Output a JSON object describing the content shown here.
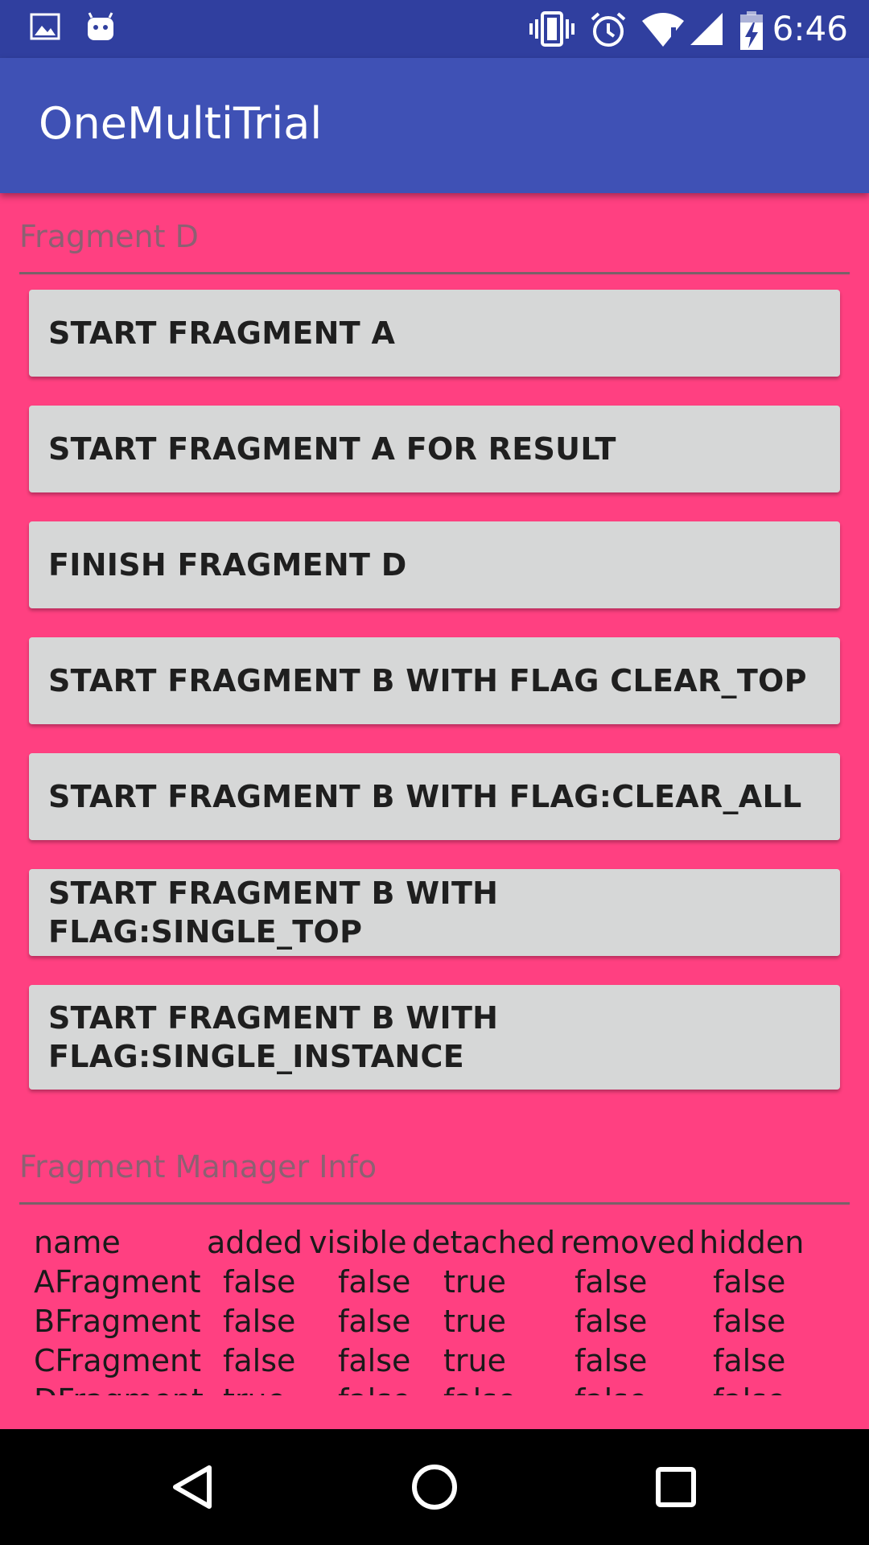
{
  "status_bar": {
    "time": "6:46",
    "left_icons": [
      "image-icon",
      "android-icon"
    ],
    "right_icons": [
      "vibrate-icon",
      "alarm-icon",
      "wifi-icon",
      "signal-icon",
      "battery-charging-icon"
    ]
  },
  "app_bar": {
    "title": "OneMultiTrial"
  },
  "fragment_section": {
    "header": "Fragment D"
  },
  "buttons": [
    {
      "label": "START FRAGMENT A"
    },
    {
      "label": "START FRAGMENT A FOR RESULT"
    },
    {
      "label": "FINISH FRAGMENT D"
    },
    {
      "label": "START FRAGMENT B WITH FLAG CLEAR_TOP"
    },
    {
      "label": "START FRAGMENT B WITH FLAG:CLEAR_ALL"
    },
    {
      "label": "START FRAGMENT B WITH FLAG:SINGLE_TOP"
    },
    {
      "label_line1": "START FRAGMENT B WITH",
      "label_line2": "FLAG:SINGLE_INSTANCE"
    }
  ],
  "info_section": {
    "header": "Fragment Manager Info",
    "columns": [
      "name",
      "added",
      "visible",
      "detached",
      "removed",
      "hidden"
    ],
    "rows": [
      [
        "AFragment",
        "false",
        "false",
        "true",
        "false",
        "false"
      ],
      [
        "BFragment",
        "false",
        "false",
        "true",
        "false",
        "false"
      ],
      [
        "CFragment",
        "false",
        "false",
        "true",
        "false",
        "false"
      ],
      [
        "DFragment",
        "true",
        "false",
        "false",
        "false",
        "false"
      ]
    ]
  },
  "nav_bar": {
    "icons": [
      "back-icon",
      "home-icon",
      "recents-icon"
    ]
  },
  "colors": {
    "status_bar": "#303f9f",
    "app_bar": "#3f51b5",
    "background": "#ff4081",
    "button": "#d6d7d7"
  }
}
